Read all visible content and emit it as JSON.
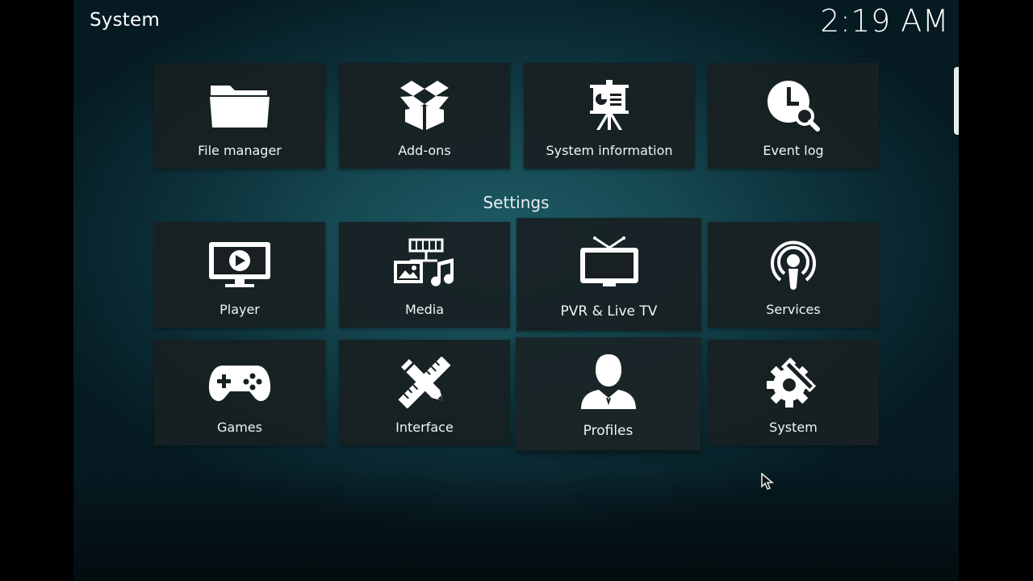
{
  "header": {
    "title": "System",
    "clock": "2:19 AM"
  },
  "top_row": [
    {
      "label": "File manager",
      "icon": "folder-icon"
    },
    {
      "label": "Add-ons",
      "icon": "addons-box-icon"
    },
    {
      "label": "System information",
      "icon": "presentation-board-icon"
    },
    {
      "label": "Event log",
      "icon": "clock-search-icon"
    }
  ],
  "settings": {
    "title": "Settings",
    "items": [
      {
        "label": "Player",
        "icon": "monitor-play-icon"
      },
      {
        "label": "Media",
        "icon": "media-collection-icon"
      },
      {
        "label": "PVR & Live TV",
        "icon": "tv-antenna-icon"
      },
      {
        "label": "Services",
        "icon": "broadcast-icon"
      },
      {
        "label": "Games",
        "icon": "gamepad-icon"
      },
      {
        "label": "Interface",
        "icon": "pencil-ruler-icon"
      },
      {
        "label": "Profiles",
        "icon": "user-profile-icon"
      },
      {
        "label": "System",
        "icon": "gear-wrench-icon"
      }
    ]
  },
  "colors": {
    "background": "#164952",
    "tile": "#182022",
    "text": "#ffffff"
  }
}
